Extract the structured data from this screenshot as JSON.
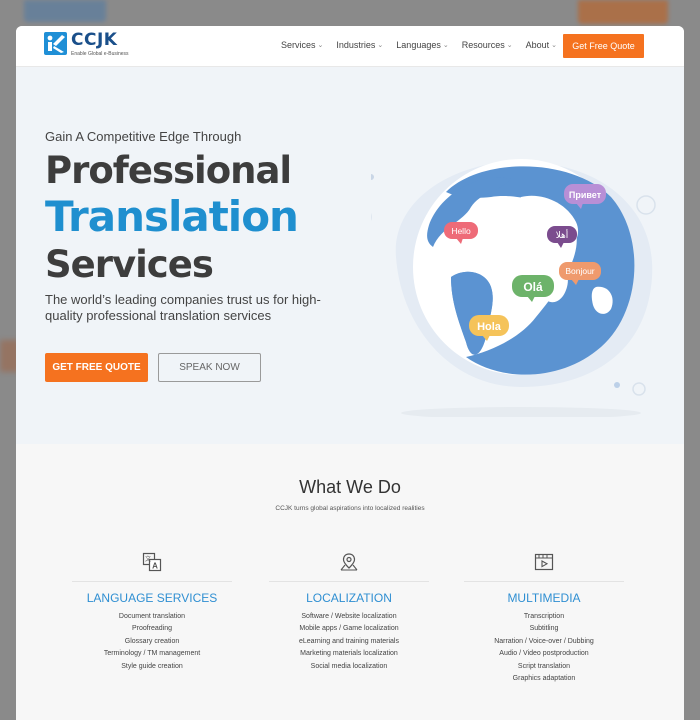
{
  "header": {
    "logo_name": "CCJK",
    "logo_tagline": "Enable Global e-Business",
    "nav": [
      {
        "label": "Services"
      },
      {
        "label": "Industries"
      },
      {
        "label": "Languages"
      },
      {
        "label": "Resources"
      },
      {
        "label": "About"
      }
    ],
    "cta": "Get Free Quote"
  },
  "hero": {
    "kicker": "Gain A Competitive Edge Through",
    "line1": "Professional",
    "line2": "Translation",
    "line3": "Services",
    "subtitle": "The world’s leading companies trust us for high-quality professional translation services",
    "primary_button": "GET FREE QUOTE",
    "secondary_button": "SPEAK NOW",
    "bubbles": {
      "b1": "Привет",
      "b2": "Hello",
      "b3": "أهلا",
      "b4": "Bonjour",
      "b5": "Olá",
      "b6": "Hola"
    }
  },
  "what_we_do": {
    "title": "What We Do",
    "subtitle": "CCJK turns global aspirations into localized realities",
    "columns": [
      {
        "title": "LANGUAGE SERVICES",
        "icon": "translate-icon",
        "items": [
          "Document translation",
          "Proofreading",
          "Glossary creation",
          "Terminology / TM management",
          "Style guide creation"
        ]
      },
      {
        "title": "LOCALIZATION",
        "icon": "location-pin-icon",
        "items": [
          "Software / Website localization",
          "Mobile apps / Game localization",
          "eLearning and training materials",
          "Marketing materials localization",
          "Social media localization"
        ]
      },
      {
        "title": "MULTIMEDIA",
        "icon": "video-icon",
        "items": [
          "Transcription",
          "Subtitling",
          "Narration / Voice-over / Dubbing",
          "Audio / Video postproduction",
          "Script translation",
          "Graphics adaptation"
        ]
      }
    ]
  },
  "colors": {
    "accent_orange": "#f5721f",
    "accent_blue": "#1f8fcf",
    "hero_bg": "#f0f4f8"
  }
}
